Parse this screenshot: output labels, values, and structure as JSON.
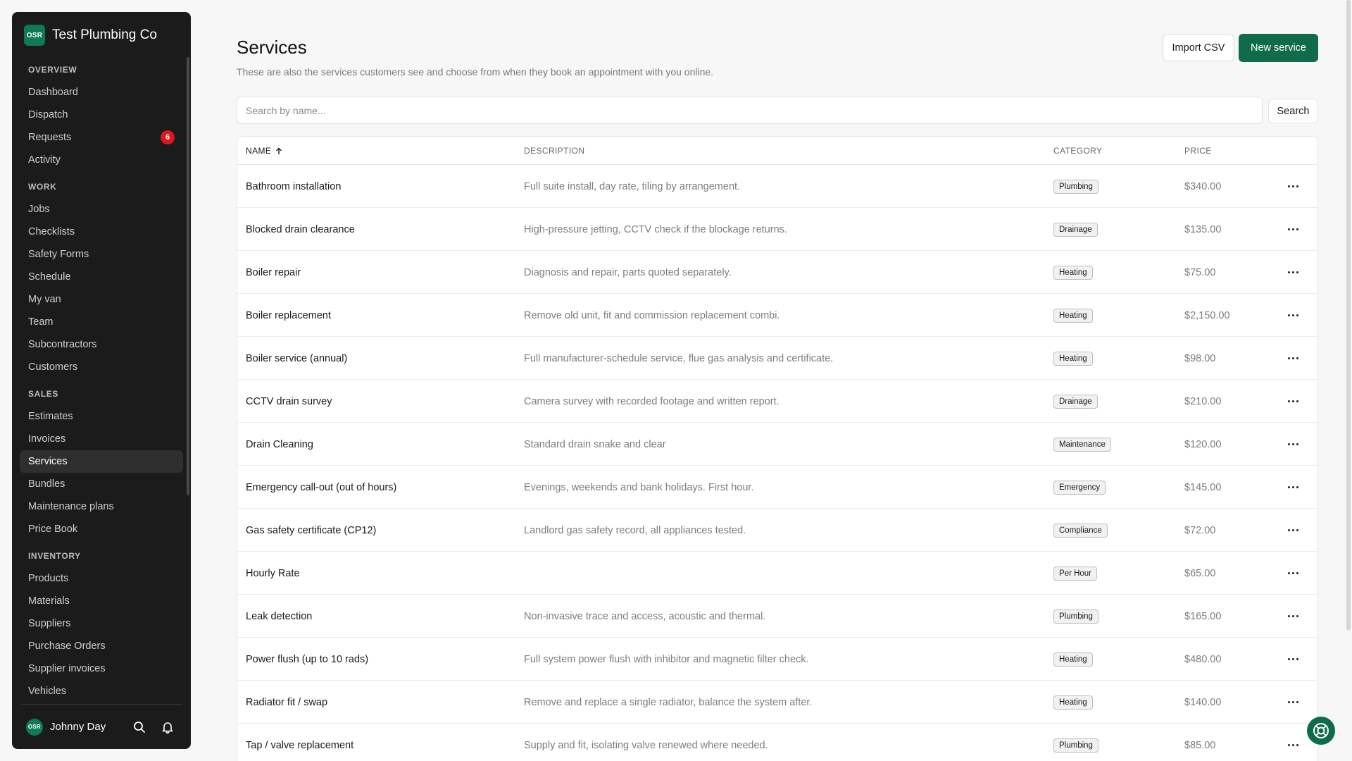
{
  "brand": {
    "logo": "OSR",
    "name": "Test Plumbing Co"
  },
  "sidebar": {
    "sections": [
      {
        "title": "OVERVIEW",
        "items": [
          {
            "label": "Dashboard"
          },
          {
            "label": "Dispatch"
          },
          {
            "label": "Requests",
            "badge": "6"
          },
          {
            "label": "Activity"
          }
        ]
      },
      {
        "title": "WORK",
        "items": [
          {
            "label": "Jobs"
          },
          {
            "label": "Checklists"
          },
          {
            "label": "Safety Forms"
          },
          {
            "label": "Schedule"
          },
          {
            "label": "My van"
          },
          {
            "label": "Team"
          },
          {
            "label": "Subcontractors"
          },
          {
            "label": "Customers"
          }
        ]
      },
      {
        "title": "SALES",
        "items": [
          {
            "label": "Estimates"
          },
          {
            "label": "Invoices"
          },
          {
            "label": "Services",
            "active": true
          },
          {
            "label": "Bundles"
          },
          {
            "label": "Maintenance plans"
          },
          {
            "label": "Price Book"
          }
        ]
      },
      {
        "title": "INVENTORY",
        "items": [
          {
            "label": "Products"
          },
          {
            "label": "Materials"
          },
          {
            "label": "Suppliers"
          },
          {
            "label": "Purchase Orders"
          },
          {
            "label": "Supplier invoices"
          },
          {
            "label": "Vehicles"
          }
        ]
      }
    ],
    "user": {
      "avatar": "OSR",
      "name": "Johnny Day"
    },
    "footer_icons": [
      "search-icon",
      "bell-icon"
    ]
  },
  "page": {
    "title": "Services",
    "subtitle": "These are also the services customers see and choose from when they book an appointment with you online.",
    "import_label": "Import CSV",
    "new_label": "New service",
    "search_placeholder": "Search by name...",
    "search_button": "Search"
  },
  "table": {
    "columns": {
      "name": "NAME",
      "description": "DESCRIPTION",
      "category": "CATEGORY",
      "price": "PRICE"
    },
    "sort_icon": "arrow-up-icon",
    "rows": [
      {
        "name": "Bathroom installation",
        "description": "Full suite install, day rate, tiling by arrangement.",
        "category": "Plumbing",
        "price": "$340.00"
      },
      {
        "name": "Blocked drain clearance",
        "description": "High-pressure jetting, CCTV check if the blockage returns.",
        "category": "Drainage",
        "price": "$135.00"
      },
      {
        "name": "Boiler repair",
        "description": "Diagnosis and repair, parts quoted separately.",
        "category": "Heating",
        "price": "$75.00"
      },
      {
        "name": "Boiler replacement",
        "description": "Remove old unit, fit and commission replacement combi.",
        "category": "Heating",
        "price": "$2,150.00"
      },
      {
        "name": "Boiler service (annual)",
        "description": "Full manufacturer-schedule service, flue gas analysis and certificate.",
        "category": "Heating",
        "price": "$98.00"
      },
      {
        "name": "CCTV drain survey",
        "description": "Camera survey with recorded footage and written report.",
        "category": "Drainage",
        "price": "$210.00"
      },
      {
        "name": "Drain Cleaning",
        "description": "Standard drain snake and clear",
        "category": "Maintenance",
        "price": "$120.00"
      },
      {
        "name": "Emergency call-out (out of hours)",
        "description": "Evenings, weekends and bank holidays. First hour.",
        "category": "Emergency",
        "price": "$145.00"
      },
      {
        "name": "Gas safety certificate (CP12)",
        "description": "Landlord gas safety record, all appliances tested.",
        "category": "Compliance",
        "price": "$72.00"
      },
      {
        "name": "Hourly Rate",
        "description": "",
        "category": "Per Hour",
        "price": "$65.00"
      },
      {
        "name": "Leak detection",
        "description": "Non-invasive trace and access, acoustic and thermal.",
        "category": "Plumbing",
        "price": "$165.00"
      },
      {
        "name": "Power flush (up to 10 rads)",
        "description": "Full system power flush with inhibitor and magnetic filter check.",
        "category": "Heating",
        "price": "$480.00"
      },
      {
        "name": "Radiator fit / swap",
        "description": "Remove and replace a single radiator, balance the system after.",
        "category": "Heating",
        "price": "$140.00"
      },
      {
        "name": "Tap / valve replacement",
        "description": "Supply and fit, isolating valve renewed where needed.",
        "category": "Plumbing",
        "price": "$85.00"
      }
    ]
  },
  "help_icon": "lifebuoy-icon",
  "colors": {
    "brand": "#0f6b4a",
    "sidebar_bg": "#1b1b1b",
    "badge": "#e0161d"
  }
}
